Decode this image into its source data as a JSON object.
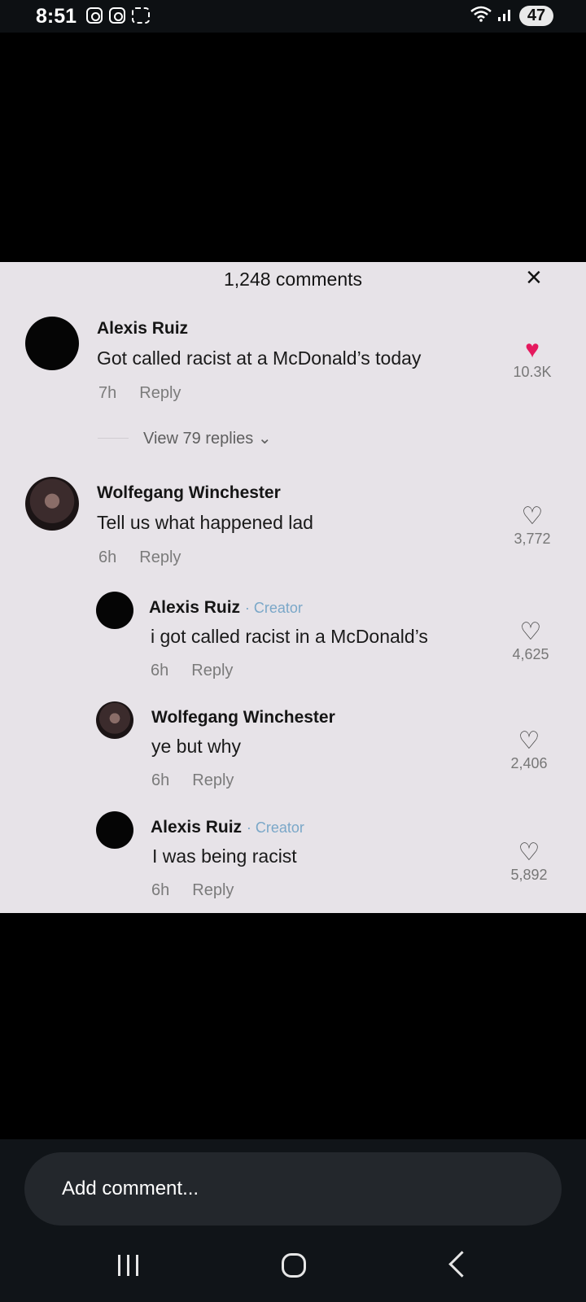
{
  "status_bar": {
    "time": "8:51",
    "left_icons": [
      "instagram-icon",
      "instagram-icon",
      "screenshot-icon"
    ],
    "right_icons": [
      "wifi-icon",
      "signal-icon"
    ],
    "battery": "47"
  },
  "comments_panel": {
    "header": "1,248 comments",
    "close_icon": "×",
    "view_replies": "View 79 replies ⌄",
    "comments": [
      {
        "author": "Alexis Ruiz",
        "badge": "",
        "text": "Got called racist at a McDonald’s today",
        "time": "7h",
        "reply": "Reply",
        "likes": "10.3K",
        "liked": true
      },
      {
        "author": "Wolfegang Winchester",
        "badge": "",
        "text": "Tell us what happened lad",
        "time": "6h",
        "reply": "Reply",
        "likes": "3,772",
        "liked": false
      },
      {
        "author": "Alexis Ruiz",
        "badge": "· Creator",
        "text": "i got called racist in a McDonald’s",
        "time": "6h",
        "reply": "Reply",
        "likes": "4,625",
        "liked": false
      },
      {
        "author": "Wolfegang Winchester",
        "badge": "",
        "text": "ye but why",
        "time": "6h",
        "reply": "Reply",
        "likes": "2,406",
        "liked": false
      },
      {
        "author": "Alexis Ruiz",
        "badge": "· Creator",
        "text": "I was being racist",
        "time": "6h",
        "reply": "Reply",
        "likes": "5,892",
        "liked": false
      }
    ]
  },
  "composer": {
    "placeholder": "Add comment..."
  },
  "colors": {
    "liked_heart": "#e5195e",
    "creator_badge": "#7aa7c8",
    "panel_bg": "#e7e3e8"
  }
}
